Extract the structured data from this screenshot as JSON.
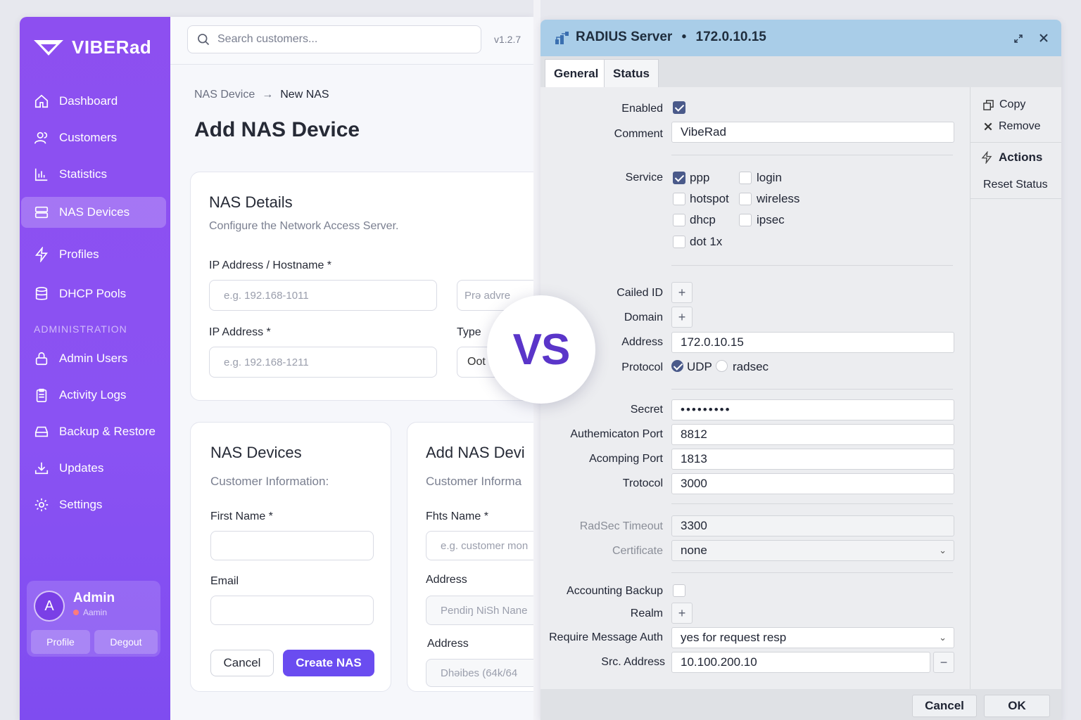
{
  "left": {
    "brand": "VIBERad",
    "nav": [
      {
        "label": "Dashboard",
        "icon": "home-icon"
      },
      {
        "label": "Customers",
        "icon": "users-icon"
      },
      {
        "label": "Statistics",
        "icon": "chart-icon"
      },
      {
        "label": "NAS Devices",
        "icon": "server-icon",
        "active": true
      },
      {
        "label": "Profiles",
        "icon": "bolt-icon"
      },
      {
        "label": "DHCP Pools",
        "icon": "database-icon"
      }
    ],
    "admin_section": "ADMINISTRATION",
    "admin_nav": [
      {
        "label": "Admin Users",
        "icon": "lock-icon"
      },
      {
        "label": "Activity Logs",
        "icon": "clipboard-icon"
      },
      {
        "label": "Backup & Restore",
        "icon": "drive-icon"
      },
      {
        "label": "Updates",
        "icon": "download-icon"
      },
      {
        "label": "Settings",
        "icon": "gear-icon"
      }
    ],
    "user": {
      "initial": "A",
      "name": "Admin",
      "role": "Aamin",
      "profile_btn": "Profile",
      "logout_btn": "Degout"
    },
    "search_placeholder": "Search customers...",
    "version": "v1.2.7",
    "breadcrumb": {
      "parent": "NAS Devicе",
      "arrow": "→",
      "current": "New NAS"
    },
    "page_title": "Add NAS Device",
    "nas_details": {
      "title": "NAS Details",
      "subtitle": "Configure the Network Access Server.",
      "ip_host_label": "IP Address / Hostname *",
      "ip_host_placeholder": "e.g. 192.168-1011",
      "extra_placeholder": "Prǝ advre",
      "ip_label": "IP Address *",
      "ip_placeholder": "e.g. 192.168-1211",
      "type_label": "Type",
      "type_value": "Oot"
    },
    "nas_devices_card": {
      "title": "NAS Devices",
      "subtitle": "Customer Information:",
      "first_name_label": "First Name *",
      "email_label": "Email",
      "cancel": "Cancel",
      "create": "Create NAS"
    },
    "add_nas_card": {
      "title": "Add NAS Devi",
      "subtitle": "Customer Informa",
      "first_name_label": "Fhts Name *",
      "first_name_placeholder": "e.g. customer mon",
      "address_label": "Address",
      "address_placeholder": "Pendiŋ NiSh Nane",
      "address2_label": "Address",
      "address2_placeholder": "Dhəibes (64k/64"
    }
  },
  "vs": "VS",
  "right": {
    "title": "RADIUS Server",
    "title_sep": "•",
    "title_ip": "172.0.10.15",
    "tabs": [
      "General",
      "Status"
    ],
    "enabled_label": "Enabled",
    "comment_label": "Comment",
    "comment_value": "VibeRad",
    "service_label": "Service",
    "services": [
      {
        "label": "ppp",
        "checked": true
      },
      {
        "label": "login",
        "checked": false
      },
      {
        "label": "hotspot",
        "checked": false
      },
      {
        "label": "wireless",
        "checked": false
      },
      {
        "label": "dhcp",
        "checked": false
      },
      {
        "label": "ipsec",
        "checked": false
      },
      {
        "label": "dot 1x",
        "checked": false
      }
    ],
    "called_id_label": "Cailed ID",
    "domain_label": "Domain",
    "address_label": "Address",
    "address_value": "172.0.10.15",
    "protocol_label": "Protocol",
    "protocol_udp": "UDP",
    "protocol_radsec": "radsec",
    "secret_label": "Secret",
    "secret_value": "•••••••••",
    "auth_port_label": "Authemicaton Port",
    "auth_port_value": "8812",
    "acct_port_label": "Acomping Port",
    "acct_port_value": "1813",
    "trotocol_label": "Trotocol",
    "trotocol_value": "3000",
    "radsec_timeout_label": "RadSec Timeout",
    "radsec_timeout_value": "3300",
    "certificate_label": "Certificate",
    "certificate_value": "none",
    "acct_backup_label": "Accounting Backup",
    "realm_label": "Realm",
    "req_msg_auth_label": "Require Message Auth",
    "req_msg_auth_value": "yes for request resp",
    "src_address_label": "Src. Address",
    "src_address_value": "10.100.200.10",
    "actions": {
      "copy": "Copy",
      "remove": "Remove",
      "actions": "Actions",
      "reset_status": "Reset Status"
    },
    "footer": {
      "cancel": "Cancel",
      "ok": "OK"
    }
  },
  "colors": {
    "brand_purple": "#8d4ff0",
    "primary_button": "#6a4cf0",
    "title_bar": "#a9cde8",
    "vs_text": "#5a35c9"
  }
}
